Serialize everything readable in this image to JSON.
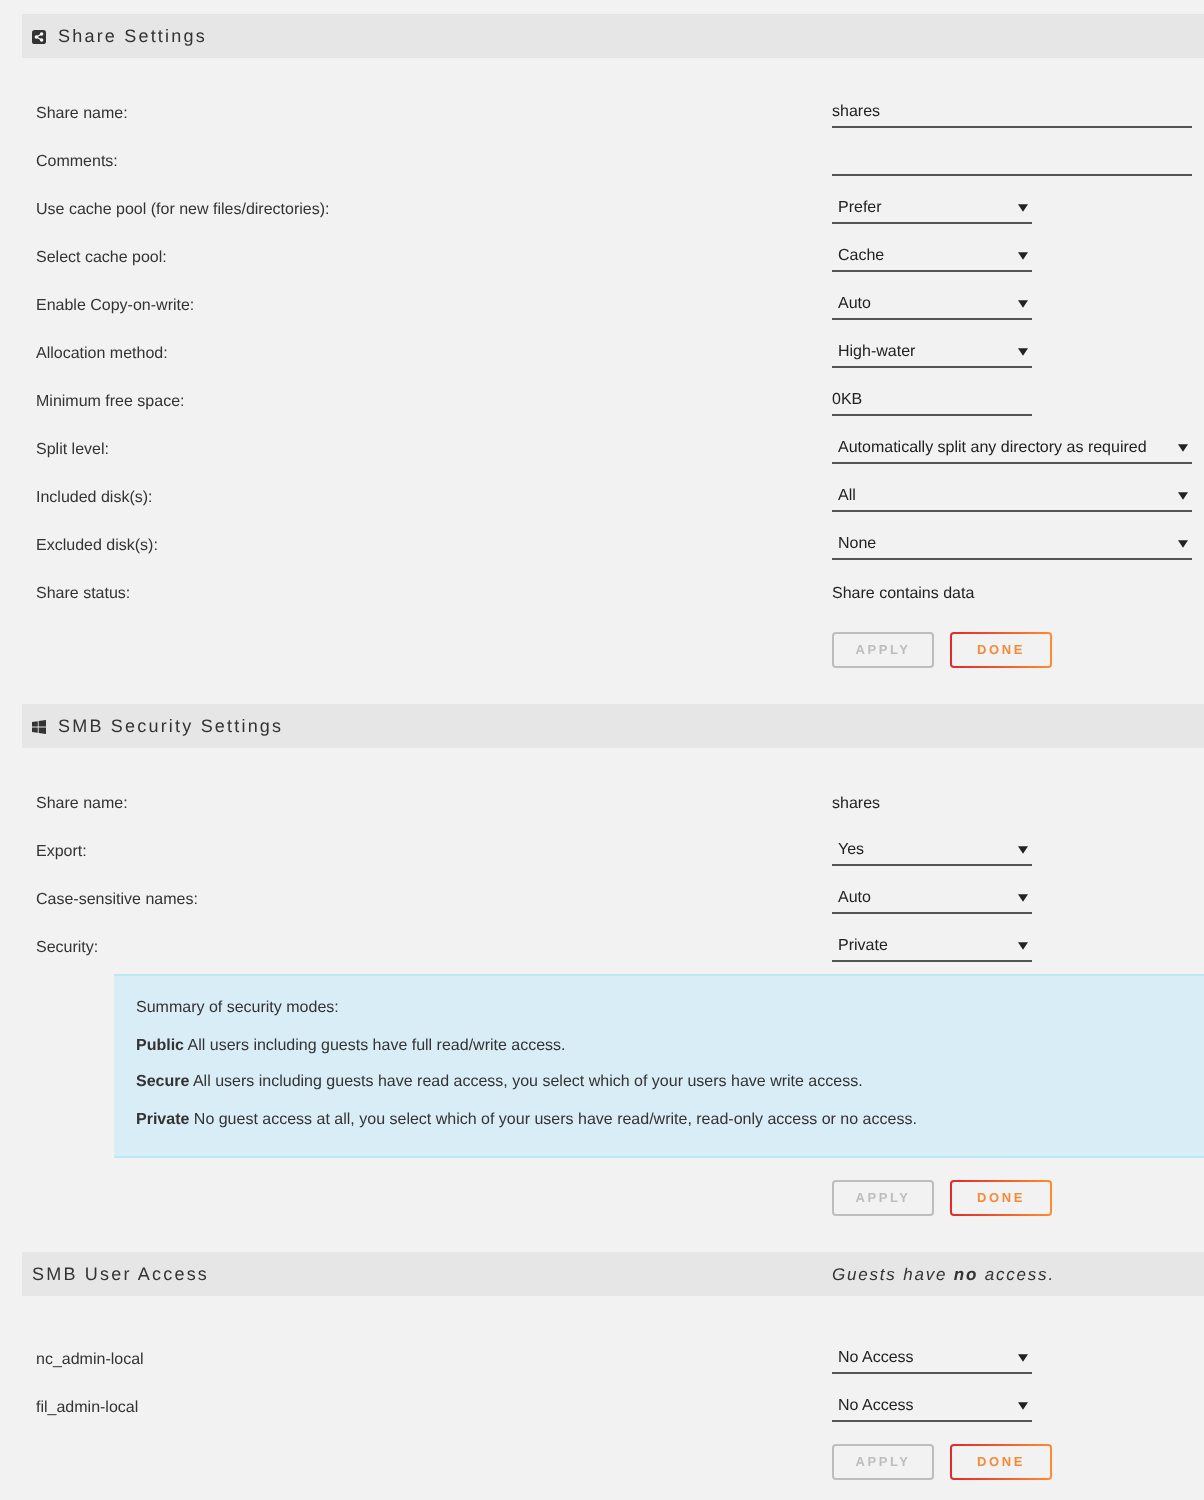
{
  "sections": [
    {
      "title": "Share Settings",
      "rows": [
        {
          "label": "Share name:",
          "kind": "input",
          "value": "shares"
        },
        {
          "label": "Comments:",
          "kind": "input"
        },
        {
          "label": "Use cache pool (for new files/directories):",
          "kind": "select",
          "value": "Prefer"
        },
        {
          "label": "Select cache pool:",
          "kind": "select",
          "value": "Cache"
        },
        {
          "label": "Enable Copy-on-write:",
          "kind": "select",
          "value": "Auto"
        },
        {
          "label": "Allocation method:",
          "kind": "select",
          "value": "High-water"
        },
        {
          "label": "Minimum free space:",
          "kind": "shortinput",
          "value": "0KB"
        },
        {
          "label": "Split level:",
          "kind": "wideselect",
          "value": "Automatically split any directory as required"
        },
        {
          "label": "Included disk(s):",
          "kind": "wideselect",
          "value": "All"
        },
        {
          "label": "Excluded disk(s):",
          "kind": "wideselect",
          "value": "None"
        },
        {
          "label": "Share status:",
          "kind": "text",
          "value": "Share contains data"
        }
      ],
      "buttons": [
        {
          "label": "APPLY",
          "disabled": true
        },
        {
          "label": "DONE",
          "disabled": false
        }
      ]
    },
    {
      "title": "SMB Security Settings",
      "rows": [
        {
          "label": "Share name:",
          "kind": "text",
          "value": "shares"
        },
        {
          "label": "Export:",
          "kind": "select",
          "value": "Yes"
        },
        {
          "label": "Case-sensitive names:",
          "kind": "select",
          "value": "Auto"
        },
        {
          "label": "Security:",
          "kind": "select",
          "value": "Private"
        }
      ],
      "summary": {
        "heading": "Summary of security modes:",
        "modes": [
          "**Public** All users including guests have full read/write access.",
          "**Secure** All users including guests have read access, you select which of your users have write access.",
          "**Private** No guest access at all, you select which of your users have read/write, read-only access or no access."
        ]
      },
      "buttons": [
        {
          "label": "APPLY",
          "disabled": true
        },
        {
          "label": "DONE",
          "disabled": false
        }
      ]
    },
    {
      "title": "SMB User Access",
      "note": "Guests have **no** access.",
      "rows": [
        {
          "label": "nc_admin-local",
          "kind": "select",
          "value": "No Access"
        },
        {
          "label": "fil_admin-local",
          "kind": "select",
          "value": "No Access"
        }
      ],
      "buttons": [
        {
          "label": "APPLY",
          "disabled": true
        },
        {
          "label": "DONE",
          "disabled": false
        }
      ]
    }
  ]
}
